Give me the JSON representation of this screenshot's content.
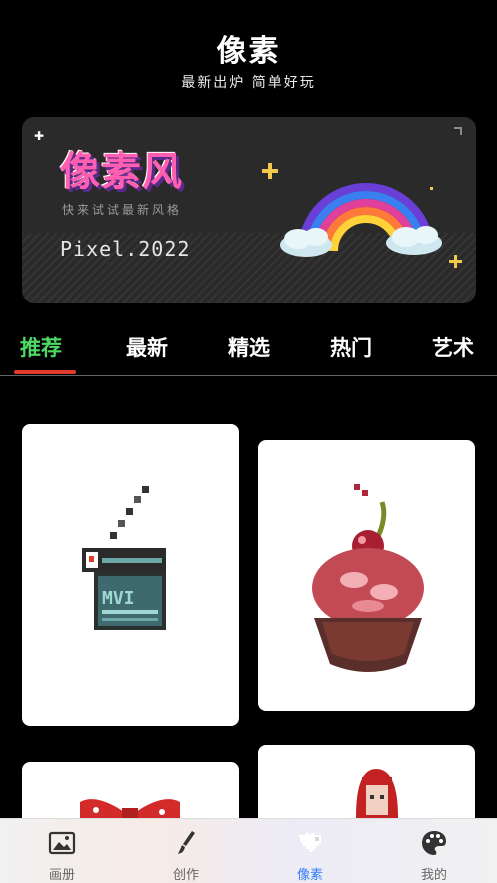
{
  "header": {
    "title": "像素",
    "subtitle": "最新出炉 简单好玩"
  },
  "banner": {
    "big_title": "像素风",
    "tagline": "快来试试最新风格",
    "pixel_text": "Pixel.2022"
  },
  "tabs": [
    {
      "label": "推荐",
      "active": true
    },
    {
      "label": "最新",
      "active": false
    },
    {
      "label": "精选",
      "active": false
    },
    {
      "label": "热门",
      "active": false
    },
    {
      "label": "艺术",
      "active": false
    }
  ],
  "gallery": [
    {
      "icon": "clapperboard-icon"
    },
    {
      "icon": "cherry-cake-icon"
    },
    {
      "icon": "red-bow-icon"
    },
    {
      "icon": "red-hair-girl-icon"
    }
  ],
  "bottom_nav": [
    {
      "label": "画册",
      "icon": "album-icon",
      "active": false
    },
    {
      "label": "创作",
      "icon": "brush-icon",
      "active": false
    },
    {
      "label": "像素",
      "icon": "pixel-heart-icon",
      "active": true
    },
    {
      "label": "我的",
      "icon": "palette-icon",
      "active": false
    }
  ],
  "colors": {
    "active_tab": "#4cd964",
    "tab_underline": "#e03b2b",
    "active_nav": "#2f7cf6"
  }
}
